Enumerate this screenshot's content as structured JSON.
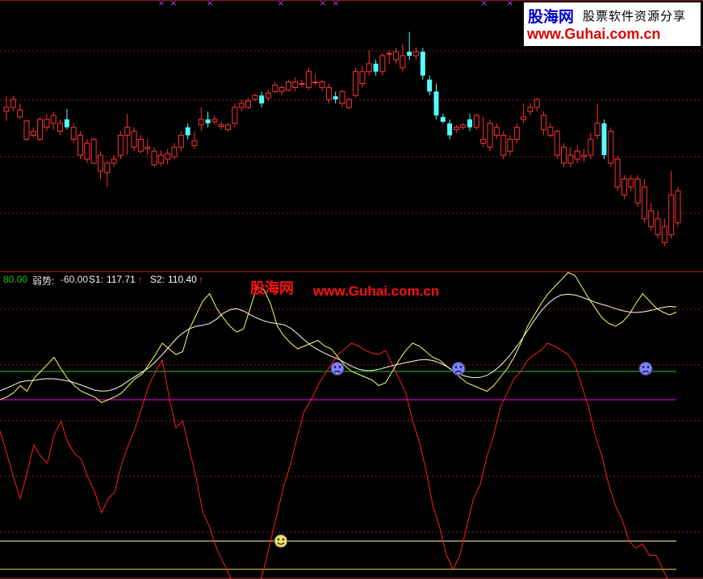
{
  "watermark": {
    "logo": "股海网",
    "tagline": "股票软件资源分享",
    "url": "www.Guhai.com.cn"
  },
  "indicator_labels": {
    "level": "80.00",
    "weak_label": "弱势:",
    "weak_value": "-60.00",
    "s1_label": "S1:",
    "s1_value": "117.71",
    "s2_label": "S2:",
    "s2_value": "110.40",
    "arrow": "↑"
  },
  "watermark2": {
    "cn": "股海网",
    "url": "www.Guhai.com.cn"
  },
  "colors": {
    "background": "#000000",
    "up_candle": "#ff3232",
    "down_candle": "#54ffff",
    "red_line": "#ff2020",
    "yellow_line": "#ffff60",
    "white_line": "#ffffe0",
    "green_level": "#20c020",
    "magenta_level": "#ff00ff",
    "grid": "#8b1a1a",
    "markers": "#c040ff"
  },
  "chart_data": [
    {
      "type": "candlestick",
      "title": "",
      "grid": "dotted horizontal",
      "ylim": [
        0,
        330
      ],
      "candles": [
        [
          195,
          200,
          183,
          214
        ],
        [
          200,
          210,
          195,
          215
        ],
        [
          188,
          197,
          186,
          205
        ],
        [
          160,
          183,
          158,
          185
        ],
        [
          165,
          170,
          162,
          175
        ],
        [
          160,
          185,
          158,
          188
        ],
        [
          175,
          185,
          170,
          192
        ],
        [
          180,
          190,
          172,
          195
        ],
        [
          170,
          180,
          165,
          185
        ],
        [
          185,
          175,
          172,
          198
        ],
        [
          160,
          175,
          155,
          180
        ],
        [
          140,
          165,
          135,
          170
        ],
        [
          135,
          155,
          130,
          160
        ],
        [
          130,
          160,
          128,
          162
        ],
        [
          120,
          140,
          110,
          145
        ],
        [
          118,
          130,
          100,
          132
        ],
        [
          130,
          135,
          125,
          140
        ],
        [
          140,
          165,
          135,
          170
        ],
        [
          165,
          175,
          140,
          192
        ],
        [
          150,
          170,
          145,
          175
        ],
        [
          145,
          160,
          142,
          165
        ],
        [
          148,
          150,
          140,
          160
        ],
        [
          128,
          145,
          125,
          150
        ],
        [
          130,
          140,
          126,
          146
        ],
        [
          135,
          142,
          128,
          148
        ],
        [
          138,
          150,
          135,
          155
        ],
        [
          150,
          165,
          145,
          170
        ],
        [
          175,
          165,
          160,
          180
        ],
        [
          152,
          158,
          148,
          170
        ],
        [
          178,
          185,
          170,
          200
        ],
        [
          185,
          180,
          175,
          195
        ],
        [
          182,
          185,
          178,
          190
        ],
        [
          176,
          178,
          172,
          182
        ],
        [
          172,
          178,
          170,
          180
        ],
        [
          180,
          200,
          175,
          205
        ],
        [
          200,
          205,
          195,
          210
        ],
        [
          200,
          208,
          198,
          212
        ],
        [
          210,
          215,
          208,
          218
        ],
        [
          215,
          205,
          200,
          220
        ],
        [
          212,
          218,
          208,
          222
        ],
        [
          220,
          228,
          218,
          232
        ],
        [
          220,
          225,
          215,
          228
        ],
        [
          222,
          232,
          220,
          235
        ],
        [
          225,
          232,
          220,
          238
        ],
        [
          230,
          230,
          225,
          235
        ],
        [
          225,
          245,
          222,
          250
        ],
        [
          232,
          232,
          228,
          242
        ],
        [
          225,
          232,
          220,
          235
        ],
        [
          210,
          225,
          205,
          230
        ],
        [
          214,
          210,
          205,
          220
        ],
        [
          205,
          220,
          200,
          222
        ],
        [
          200,
          210,
          198,
          212
        ],
        [
          215,
          245,
          212,
          250
        ],
        [
          230,
          245,
          225,
          252
        ],
        [
          245,
          255,
          240,
          272
        ],
        [
          255,
          245,
          240,
          260
        ],
        [
          245,
          265,
          240,
          268
        ],
        [
          268,
          268,
          255,
          272
        ],
        [
          260,
          270,
          255,
          275
        ],
        [
          250,
          265,
          245,
          280
        ],
        [
          270,
          265,
          260,
          295
        ],
        [
          265,
          270,
          260,
          275
        ],
        [
          270,
          240,
          235,
          275
        ],
        [
          235,
          220,
          215,
          240
        ],
        [
          220,
          190,
          185,
          230
        ],
        [
          188,
          182,
          180,
          192
        ],
        [
          180,
          165,
          160,
          185
        ],
        [
          172,
          175,
          168,
          178
        ],
        [
          175,
          178,
          172,
          180
        ],
        [
          185,
          175,
          170,
          192
        ],
        [
          175,
          190,
          172,
          192
        ],
        [
          155,
          160,
          150,
          188
        ],
        [
          150,
          180,
          145,
          185
        ],
        [
          165,
          175,
          160,
          180
        ],
        [
          140,
          165,
          135,
          170
        ],
        [
          145,
          160,
          140,
          165
        ],
        [
          160,
          175,
          155,
          180
        ],
        [
          185,
          188,
          180,
          205
        ],
        [
          195,
          200,
          190,
          205
        ],
        [
          200,
          210,
          195,
          212
        ],
        [
          172,
          190,
          165,
          195
        ],
        [
          165,
          175,
          162,
          180
        ],
        [
          140,
          170,
          135,
          172
        ],
        [
          130,
          150,
          125,
          155
        ],
        [
          130,
          140,
          125,
          150
        ],
        [
          135,
          145,
          130,
          152
        ],
        [
          138,
          140,
          132,
          148
        ],
        [
          140,
          160,
          135,
          168
        ],
        [
          165,
          180,
          160,
          205
        ],
        [
          180,
          140,
          135,
          185
        ],
        [
          130,
          170,
          125,
          175
        ],
        [
          100,
          135,
          95,
          140
        ],
        [
          90,
          110,
          85,
          115
        ],
        [
          100,
          110,
          95,
          115
        ],
        [
          80,
          110,
          75,
          115
        ],
        [
          60,
          100,
          55,
          110
        ],
        [
          50,
          70,
          45,
          80
        ],
        [
          40,
          60,
          35,
          70
        ],
        [
          30,
          50,
          25,
          60
        ],
        [
          40,
          90,
          35,
          120
        ],
        [
          55,
          95,
          50,
          100
        ]
      ]
    },
    {
      "type": "line",
      "title": "",
      "ylim": [
        -60,
        140
      ],
      "levels": [
        80,
        60,
        -40,
        -60
      ],
      "series_red": [
        38,
        22,
        5,
        -10,
        8,
        28,
        20,
        15,
        35,
        45,
        30,
        22,
        18,
        5,
        -5,
        -20,
        -10,
        -5,
        15,
        28,
        40,
        55,
        70,
        80,
        88,
        62,
        40,
        45,
        25,
        5,
        -20,
        -30,
        -45,
        -55,
        -65,
        -75,
        -80,
        -85,
        -78,
        -60,
        -40,
        -20,
        0,
        15,
        35,
        52,
        60,
        70,
        78,
        85,
        92,
        96,
        100,
        98,
        95,
        93,
        92,
        95,
        85,
        75,
        65,
        45,
        30,
        10,
        -15,
        -30,
        -50,
        -60,
        -50,
        -30,
        -10,
        0,
        20,
        35,
        55,
        65,
        75,
        80,
        88,
        92,
        95,
        100,
        98,
        95,
        92,
        85,
        70,
        55,
        35,
        20,
        0,
        -15,
        -25,
        -40,
        -45,
        -42,
        -50,
        -50,
        -60,
        -70,
        -80
      ],
      "series_yellow": [
        60,
        62,
        65,
        70,
        66,
        75,
        80,
        85,
        90,
        82,
        75,
        70,
        66,
        64,
        62,
        58,
        60,
        62,
        65,
        70,
        75,
        78,
        85,
        92,
        100,
        96,
        92,
        94,
        110,
        120,
        130,
        135,
        125,
        118,
        112,
        108,
        110,
        125,
        140,
        138,
        128,
        112,
        105,
        100,
        96,
        98,
        100,
        102,
        98,
        96,
        90,
        84,
        80,
        78,
        76,
        74,
        70,
        72,
        80,
        88,
        95,
        100,
        98,
        94,
        90,
        88,
        84,
        80,
        76,
        72,
        70,
        68,
        66,
        70,
        76,
        82,
        90,
        100,
        112,
        120,
        128,
        135,
        140,
        145,
        150,
        148,
        140,
        132,
        125,
        118,
        114,
        112,
        115,
        120,
        128,
        135,
        130,
        125,
        122,
        120,
        122
      ],
      "markers": [
        {
          "type": "frown",
          "value": 82
        },
        {
          "type": "frown",
          "value": 82
        },
        {
          "type": "frown",
          "value": 82
        },
        {
          "type": "smile",
          "value": -40
        }
      ]
    }
  ]
}
